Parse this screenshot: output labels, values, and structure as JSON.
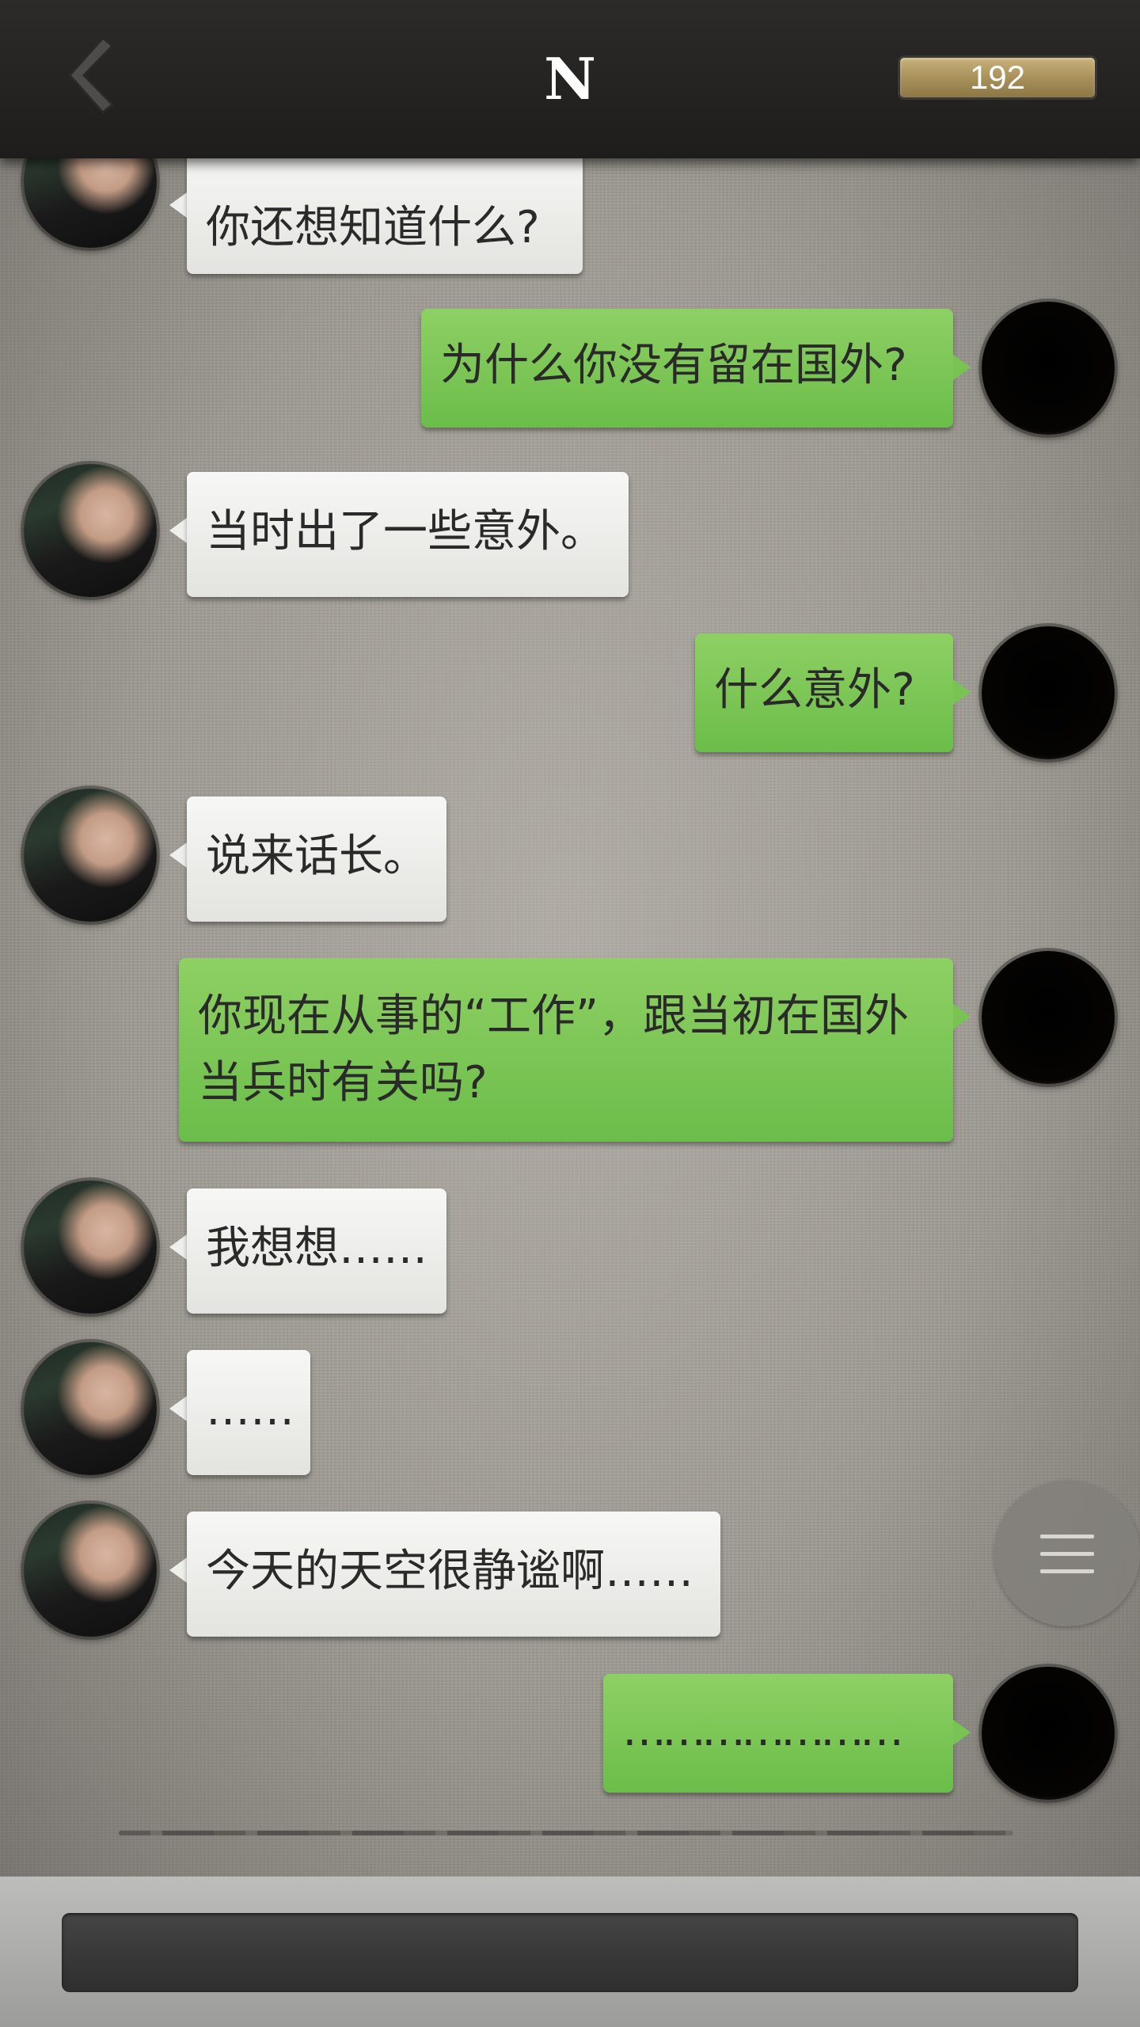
{
  "header": {
    "back_icon": "chevron-left-icon",
    "title": "N",
    "counter": "192"
  },
  "messages": [
    {
      "sender": "npc",
      "text": "你还想知道什么?"
    },
    {
      "sender": "me",
      "text": "为什么你没有留在国外?"
    },
    {
      "sender": "npc",
      "text": "当时出了一些意外。"
    },
    {
      "sender": "me",
      "text": "什么意外?"
    },
    {
      "sender": "npc",
      "text": "说来话长。"
    },
    {
      "sender": "me",
      "text": "你现在从事的“工作”，跟当初在国外当兵时有关吗?"
    },
    {
      "sender": "npc",
      "text": "我想想……"
    },
    {
      "sender": "npc",
      "text": "……"
    },
    {
      "sender": "npc",
      "text": "今天的天空很静谧啊……"
    },
    {
      "sender": "me",
      "text": "…………………"
    }
  ],
  "menu_button": {
    "icon": "hamburger-menu-icon"
  },
  "input": {
    "icon": "reply-bar"
  }
}
